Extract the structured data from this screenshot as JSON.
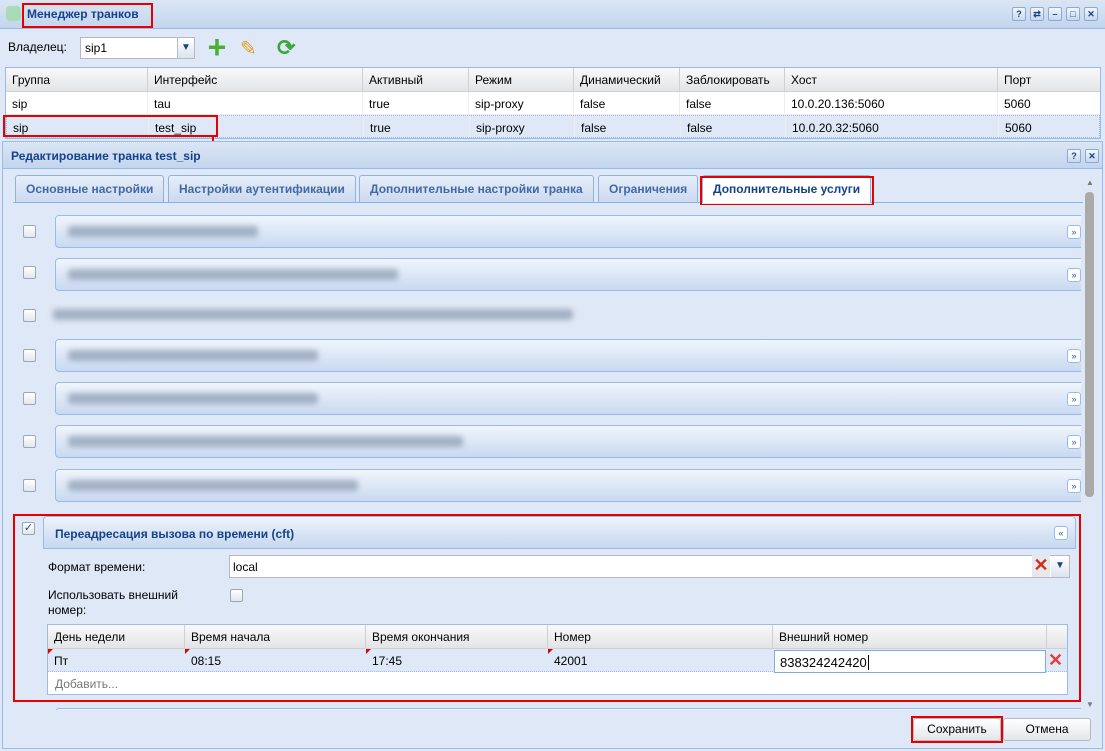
{
  "manager": {
    "title": "Менеджер транков",
    "owner_label": "Владелец:",
    "owner_value": "sip1",
    "columns": [
      "Группа",
      "Интерфейс",
      "Активный",
      "Режим",
      "Динамический",
      "Заблокировать",
      "Хост",
      "Порт"
    ],
    "rows": [
      [
        "sip",
        "tau",
        "true",
        "sip-proxy",
        "false",
        "false",
        "10.0.20.136:5060",
        "5060"
      ],
      [
        "sip",
        "test_sip",
        "true",
        "sip-proxy",
        "false",
        "false",
        "10.0.20.32:5060",
        "5060"
      ]
    ]
  },
  "editor": {
    "title": "Редактирование транка test_sip",
    "tabs": [
      "Основные настройки",
      "Настройки аутентификации",
      "Дополнительные настройки транка",
      "Ограничения",
      "Дополнительные услуги"
    ],
    "active_tab": 4,
    "cft": {
      "title": "Переадресация вызова по времени (cft)",
      "enabled": true,
      "time_format_label": "Формат времени:",
      "time_format_value": "local",
      "use_external_label": "Использовать внешний номер:",
      "use_external": false,
      "columns": [
        "День недели",
        "Время начала",
        "Время окончания",
        "Номер",
        "Внешний номер"
      ],
      "row": [
        "Пт",
        "08:15",
        "17:45",
        "42001",
        "838324242420"
      ],
      "add_label": "Добавить..."
    },
    "save_label": "Сохранить",
    "cancel_label": "Отмена"
  },
  "colors": {
    "highlight": "#e60000",
    "title": "#15428b"
  }
}
